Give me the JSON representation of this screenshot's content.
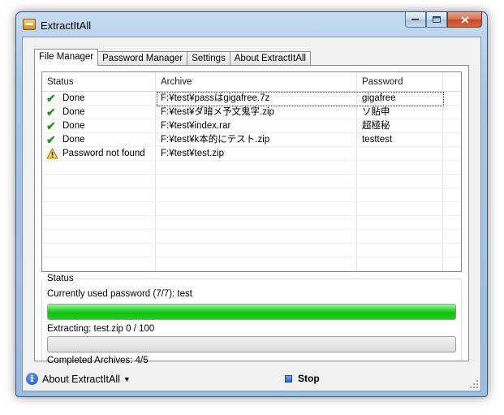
{
  "window": {
    "title": "ExtractItAll"
  },
  "tabs": [
    {
      "label": "File Manager",
      "active": true
    },
    {
      "label": "Password Manager",
      "active": false
    },
    {
      "label": "Settings",
      "active": false
    },
    {
      "label": "About ExtractItAll",
      "active": false
    }
  ],
  "list": {
    "columns": [
      "Status",
      "Archive",
      "Password"
    ],
    "rows": [
      {
        "status": "Done",
        "status_icon": "check-icon",
        "archive": "F:¥test¥passはgigafree.7z",
        "password": "gigafree"
      },
      {
        "status": "Done",
        "status_icon": "check-icon",
        "archive": "F:¥test¥ダ暗メ予文鬼字.zip",
        "password": "ソ貼申"
      },
      {
        "status": "Done",
        "status_icon": "check-icon",
        "archive": "F:¥test¥index.rar",
        "password": "超極秘"
      },
      {
        "status": "Done",
        "status_icon": "check-icon",
        "archive": "F:¥test¥k本的にテスト.zip",
        "password": "testtest"
      },
      {
        "status": "Password not found",
        "status_icon": "warning-icon",
        "archive": "F:¥test¥test.zip",
        "password": ""
      }
    ]
  },
  "status": {
    "title": "Status",
    "password_line": "Currently used password (7/7): test",
    "password_progress": 1.0,
    "extracting_line": "Extracting: test.zip 0 / 100",
    "extract_progress": 0.0,
    "completed_line": "Completed Archives: 4/5"
  },
  "bottombar": {
    "about_label": "About ExtractItAll",
    "stop_label": "Stop"
  },
  "colors": {
    "progress_green": "#10bf10",
    "check_green": "#2b8a2b"
  }
}
